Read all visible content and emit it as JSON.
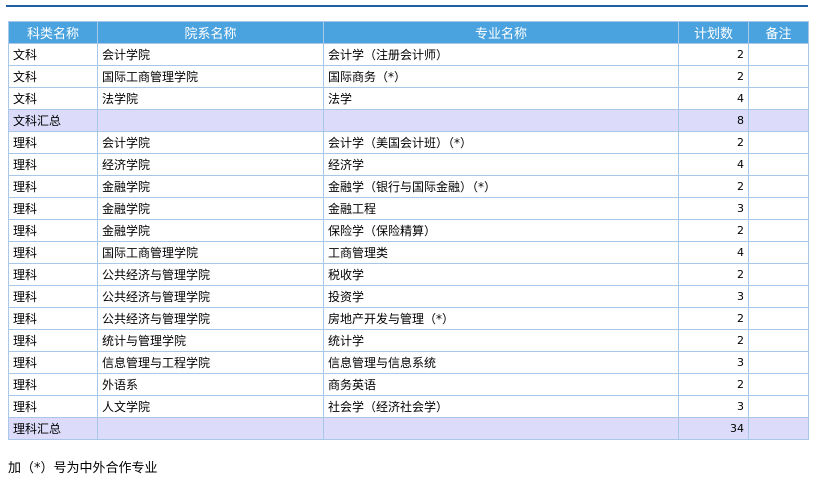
{
  "table": {
    "headers": [
      "科类名称",
      "院系名称",
      "专业名称",
      "计划数",
      "备注"
    ],
    "rows": [
      {
        "category": "文科",
        "school": "会计学院",
        "major": "会计学（注册会计师）",
        "count": "2",
        "note": "",
        "summary": false
      },
      {
        "category": "文科",
        "school": "国际工商管理学院",
        "major": "国际商务（*）",
        "count": "2",
        "note": "",
        "summary": false
      },
      {
        "category": "文科",
        "school": "法学院",
        "major": "法学",
        "count": "4",
        "note": "",
        "summary": false
      },
      {
        "category": "文科汇总",
        "school": "",
        "major": "",
        "count": "8",
        "note": "",
        "summary": true
      },
      {
        "category": "理科",
        "school": "会计学院",
        "major": "会计学（美国会计班）（*）",
        "count": "2",
        "note": "",
        "summary": false
      },
      {
        "category": "理科",
        "school": "经济学院",
        "major": "经济学",
        "count": "4",
        "note": "",
        "summary": false
      },
      {
        "category": "理科",
        "school": "金融学院",
        "major": "金融学（银行与国际金融）（*）",
        "count": "2",
        "note": "",
        "summary": false
      },
      {
        "category": "理科",
        "school": "金融学院",
        "major": "金融工程",
        "count": "3",
        "note": "",
        "summary": false
      },
      {
        "category": "理科",
        "school": "金融学院",
        "major": "保险学（保险精算）",
        "count": "2",
        "note": "",
        "summary": false
      },
      {
        "category": "理科",
        "school": "国际工商管理学院",
        "major": "工商管理类",
        "count": "4",
        "note": "",
        "summary": false
      },
      {
        "category": "理科",
        "school": "公共经济与管理学院",
        "major": "税收学",
        "count": "2",
        "note": "",
        "summary": false
      },
      {
        "category": "理科",
        "school": "公共经济与管理学院",
        "major": "投资学",
        "count": "3",
        "note": "",
        "summary": false
      },
      {
        "category": "理科",
        "school": "公共经济与管理学院",
        "major": "房地产开发与管理（*）",
        "count": "2",
        "note": "",
        "summary": false
      },
      {
        "category": "理科",
        "school": "统计与管理学院",
        "major": "统计学",
        "count": "2",
        "note": "",
        "summary": false
      },
      {
        "category": "理科",
        "school": "信息管理与工程学院",
        "major": "信息管理与信息系统",
        "count": "3",
        "note": "",
        "summary": false
      },
      {
        "category": "理科",
        "school": "外语系",
        "major": "商务英语",
        "count": "2",
        "note": "",
        "summary": false
      },
      {
        "category": "理科",
        "school": "人文学院",
        "major": "社会学（经济社会学）",
        "count": "3",
        "note": "",
        "summary": false
      },
      {
        "category": "理科汇总",
        "school": "",
        "major": "",
        "count": "34",
        "note": "",
        "summary": true
      }
    ]
  },
  "footnote": "加（*）号为中外合作专业",
  "colors": {
    "header_bg": "#4aa3df",
    "summary_row_bg": "#dcdcfa",
    "border": "#a9c7e8",
    "top_rule": "#1f5fa8"
  }
}
